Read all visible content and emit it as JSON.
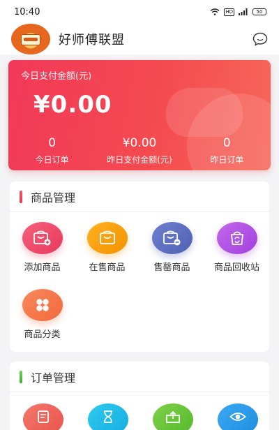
{
  "status_bar": {
    "time": "10:40",
    "network": "HD",
    "battery": "50"
  },
  "header": {
    "store_name": "好师傅联盟",
    "chat_icon": "chat-bubble-icon"
  },
  "revenue": {
    "today_label": "今日支付金额(元)",
    "today_amount": "¥0.00",
    "stats": [
      {
        "value": "0",
        "label": "今日订单"
      },
      {
        "value": "¥0.00",
        "label": "昨日支付金额(元)"
      },
      {
        "value": "0",
        "label": "昨日订单"
      }
    ]
  },
  "product_section": {
    "title": "商品管理",
    "accent": "#e8344f",
    "items": [
      {
        "label": "添加商品",
        "icon": "add-product-icon",
        "color": "#e9395b"
      },
      {
        "label": "在售商品",
        "icon": "on-sale-icon",
        "color": "#f39200"
      },
      {
        "label": "售罄商品",
        "icon": "sold-out-icon",
        "color": "#4f61b4"
      },
      {
        "label": "商品回收站",
        "icon": "recycle-bin-icon",
        "color": "#a240de"
      },
      {
        "label": "商品分类",
        "icon": "category-icon",
        "color": "#f26a3c"
      }
    ]
  },
  "order_section": {
    "title": "订单管理",
    "accent": "#4cbb3a",
    "icons": [
      "order-list-icon",
      "pending-hourglass-icon",
      "shipping-box-icon",
      "view-eye-icon"
    ]
  }
}
